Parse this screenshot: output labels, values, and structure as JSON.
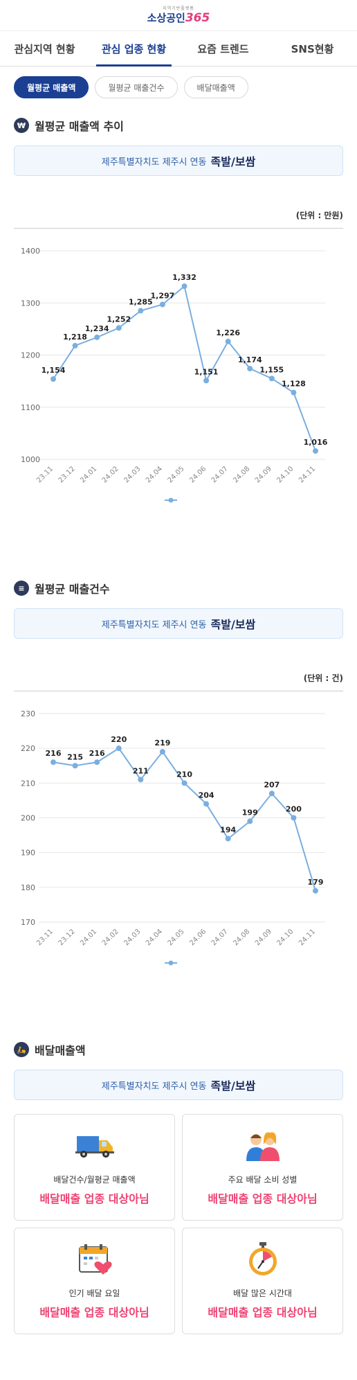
{
  "header": {
    "logo_sub": "지역기반플랫폼",
    "logo_main_1": "소상공인",
    "logo_main_2": "365"
  },
  "tabs": [
    {
      "label": "관심지역 현황",
      "active": false
    },
    {
      "label": "관심 업종 현황",
      "active": true
    },
    {
      "label": "요즘 트렌드",
      "active": false
    },
    {
      "label": "SNS현황",
      "active": false
    }
  ],
  "pills": [
    {
      "label": "월평균 매출액",
      "active": true
    },
    {
      "label": "월평균 매출건수",
      "active": false
    },
    {
      "label": "배달매출액",
      "active": false
    }
  ],
  "region": {
    "prefix": "제주특별자치도 제주시 연동",
    "category": "족발/보쌈"
  },
  "sections": {
    "sales": {
      "title": "월평균 매출액 추이",
      "unit": "(단위 : 만원)"
    },
    "count": {
      "title": "월평균 매출건수",
      "unit": "(단위 : 건)"
    },
    "delivery": {
      "title": "배달매출액"
    }
  },
  "chart_data": [
    {
      "type": "line",
      "title": "월평균 매출액 추이",
      "categories": [
        "23.11",
        "23.12",
        "24.01",
        "24.02",
        "24.03",
        "24.04",
        "24.05",
        "24.06",
        "24.07",
        "24.08",
        "24.09",
        "24.10",
        "24.11"
      ],
      "values": [
        1154,
        1218,
        1234,
        1252,
        1285,
        1297,
        1332,
        1151,
        1226,
        1174,
        1155,
        1128,
        1016
      ],
      "labels": [
        "1,154",
        "1,218",
        "1,234",
        "1,252",
        "1,285",
        "1,297",
        "1,332",
        "1,151",
        "1,226",
        "1,174",
        "1,155",
        "1,128",
        "1,016"
      ],
      "yticks": [
        1000,
        1100,
        1200,
        1300,
        1400
      ],
      "ylim": [
        1000,
        1400
      ],
      "grid": true,
      "color": "#7aaee0"
    },
    {
      "type": "line",
      "title": "월평균 매출건수",
      "categories": [
        "23.11",
        "23.12",
        "24.01",
        "24.02",
        "24.03",
        "24.04",
        "24.05",
        "24.06",
        "24.07",
        "24.08",
        "24.09",
        "24.10",
        "24.11"
      ],
      "values": [
        216,
        215,
        216,
        220,
        211,
        219,
        210,
        204,
        194,
        199,
        207,
        200,
        179
      ],
      "labels": [
        "216",
        "215",
        "216",
        "220",
        "211",
        "219",
        "210",
        "204",
        "194",
        "199",
        "207",
        "200",
        "179"
      ],
      "yticks": [
        170,
        180,
        190,
        200,
        210,
        220,
        230
      ],
      "ylim": [
        170,
        230
      ],
      "grid": true,
      "color": "#7aaee0"
    }
  ],
  "delivery_cards": [
    {
      "label": "배달건수/월평균 매출액",
      "value": "배달매출 업종 대상아님",
      "icon": "delivery-truck-icon"
    },
    {
      "label": "주요 배달 소비 성별",
      "value": "배달매출 업종 대상아님",
      "icon": "couple-icon"
    },
    {
      "label": "인기 배달 요일",
      "value": "배달매출 업종 대상아님",
      "icon": "calendar-heart-icon"
    },
    {
      "label": "배달 많은 시간대",
      "value": "배달매출 업종 대상아님",
      "icon": "stopwatch-icon"
    }
  ],
  "colors": {
    "brand": "#1b3f93",
    "accent": "#ee4272",
    "line": "#7aaee0"
  }
}
